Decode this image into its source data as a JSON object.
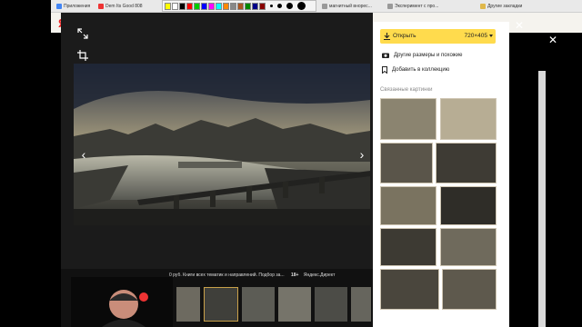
{
  "browser": {
    "bookmarks": [
      "Приложения",
      "Dem Its Good 808"
    ],
    "tabs": [
      "магнитный вноpec...",
      "Эксперимент с прo...",
      "Другие закладки"
    ]
  },
  "viewer": {
    "strip_text": "0 руб. Книги всех тематик и направлений. Подбор за...",
    "strip_meta_1": "18+",
    "strip_meta_2": "Яндекс.Директ"
  },
  "panel": {
    "open_label": "Открыть",
    "size_label": "720×405",
    "other_sizes_label": "Другие размеры и похожие",
    "add_collection_label": "Добавить в коллекцию",
    "related_title": "Связанные картинки"
  },
  "colors": {
    "open_button": "#ffdb4d",
    "viewer_bg": "#1b1b1b",
    "panel_bg": "#ffffff"
  },
  "icons": [
    "fullscreen-icon",
    "crop-icon",
    "download-icon",
    "camera-icon",
    "bookmark-icon",
    "close-icon"
  ]
}
